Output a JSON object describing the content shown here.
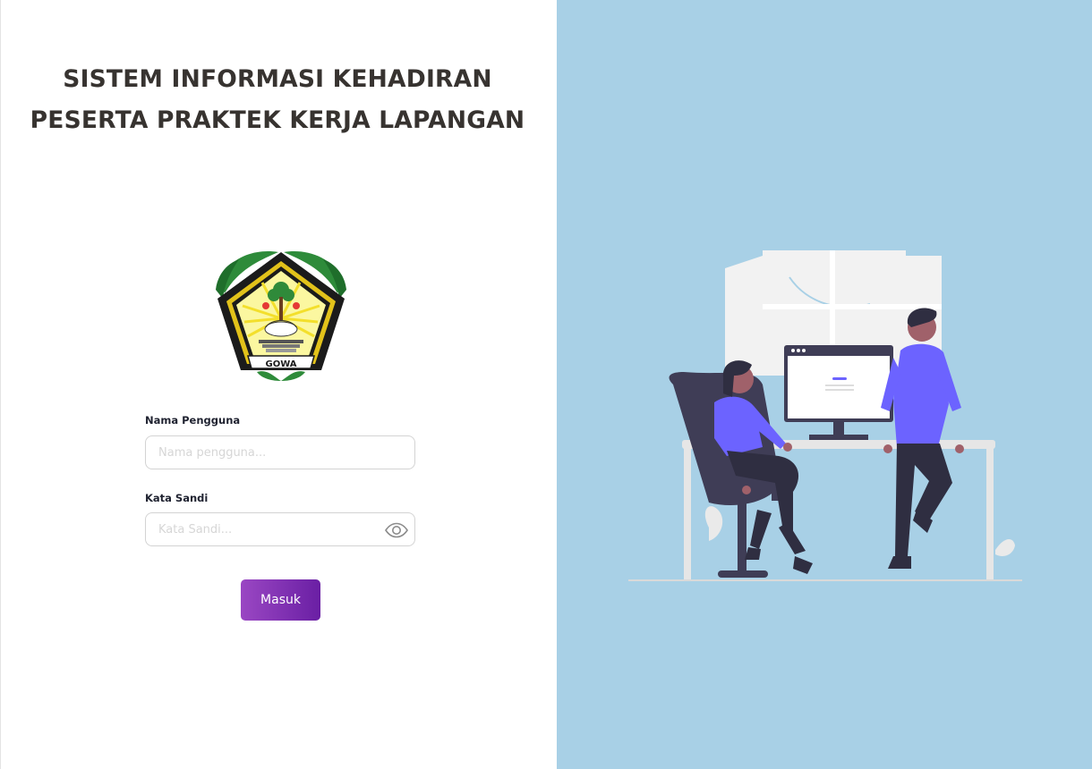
{
  "app": {
    "title_line1": "SISTEM INFORMASI KEHADIRAN",
    "title_line2": "PESERTA PRAKTEK KERJA LAPANGAN"
  },
  "logo": {
    "text": "GOWA"
  },
  "form": {
    "username_label": "Nama Pengguna",
    "username_placeholder": "Nama pengguna...",
    "username_value": "",
    "password_label": "Kata Sandi",
    "password_placeholder": "Kata Sandi...",
    "password_value": "",
    "password_toggle_icon": "eye-icon",
    "submit_label": "Masuk"
  },
  "colors": {
    "right_panel_bg": "#a8d0e6",
    "button_gradient_start": "#9a47c3",
    "button_gradient_end": "#6a1fa4",
    "illustration_accent": "#6c63ff"
  }
}
